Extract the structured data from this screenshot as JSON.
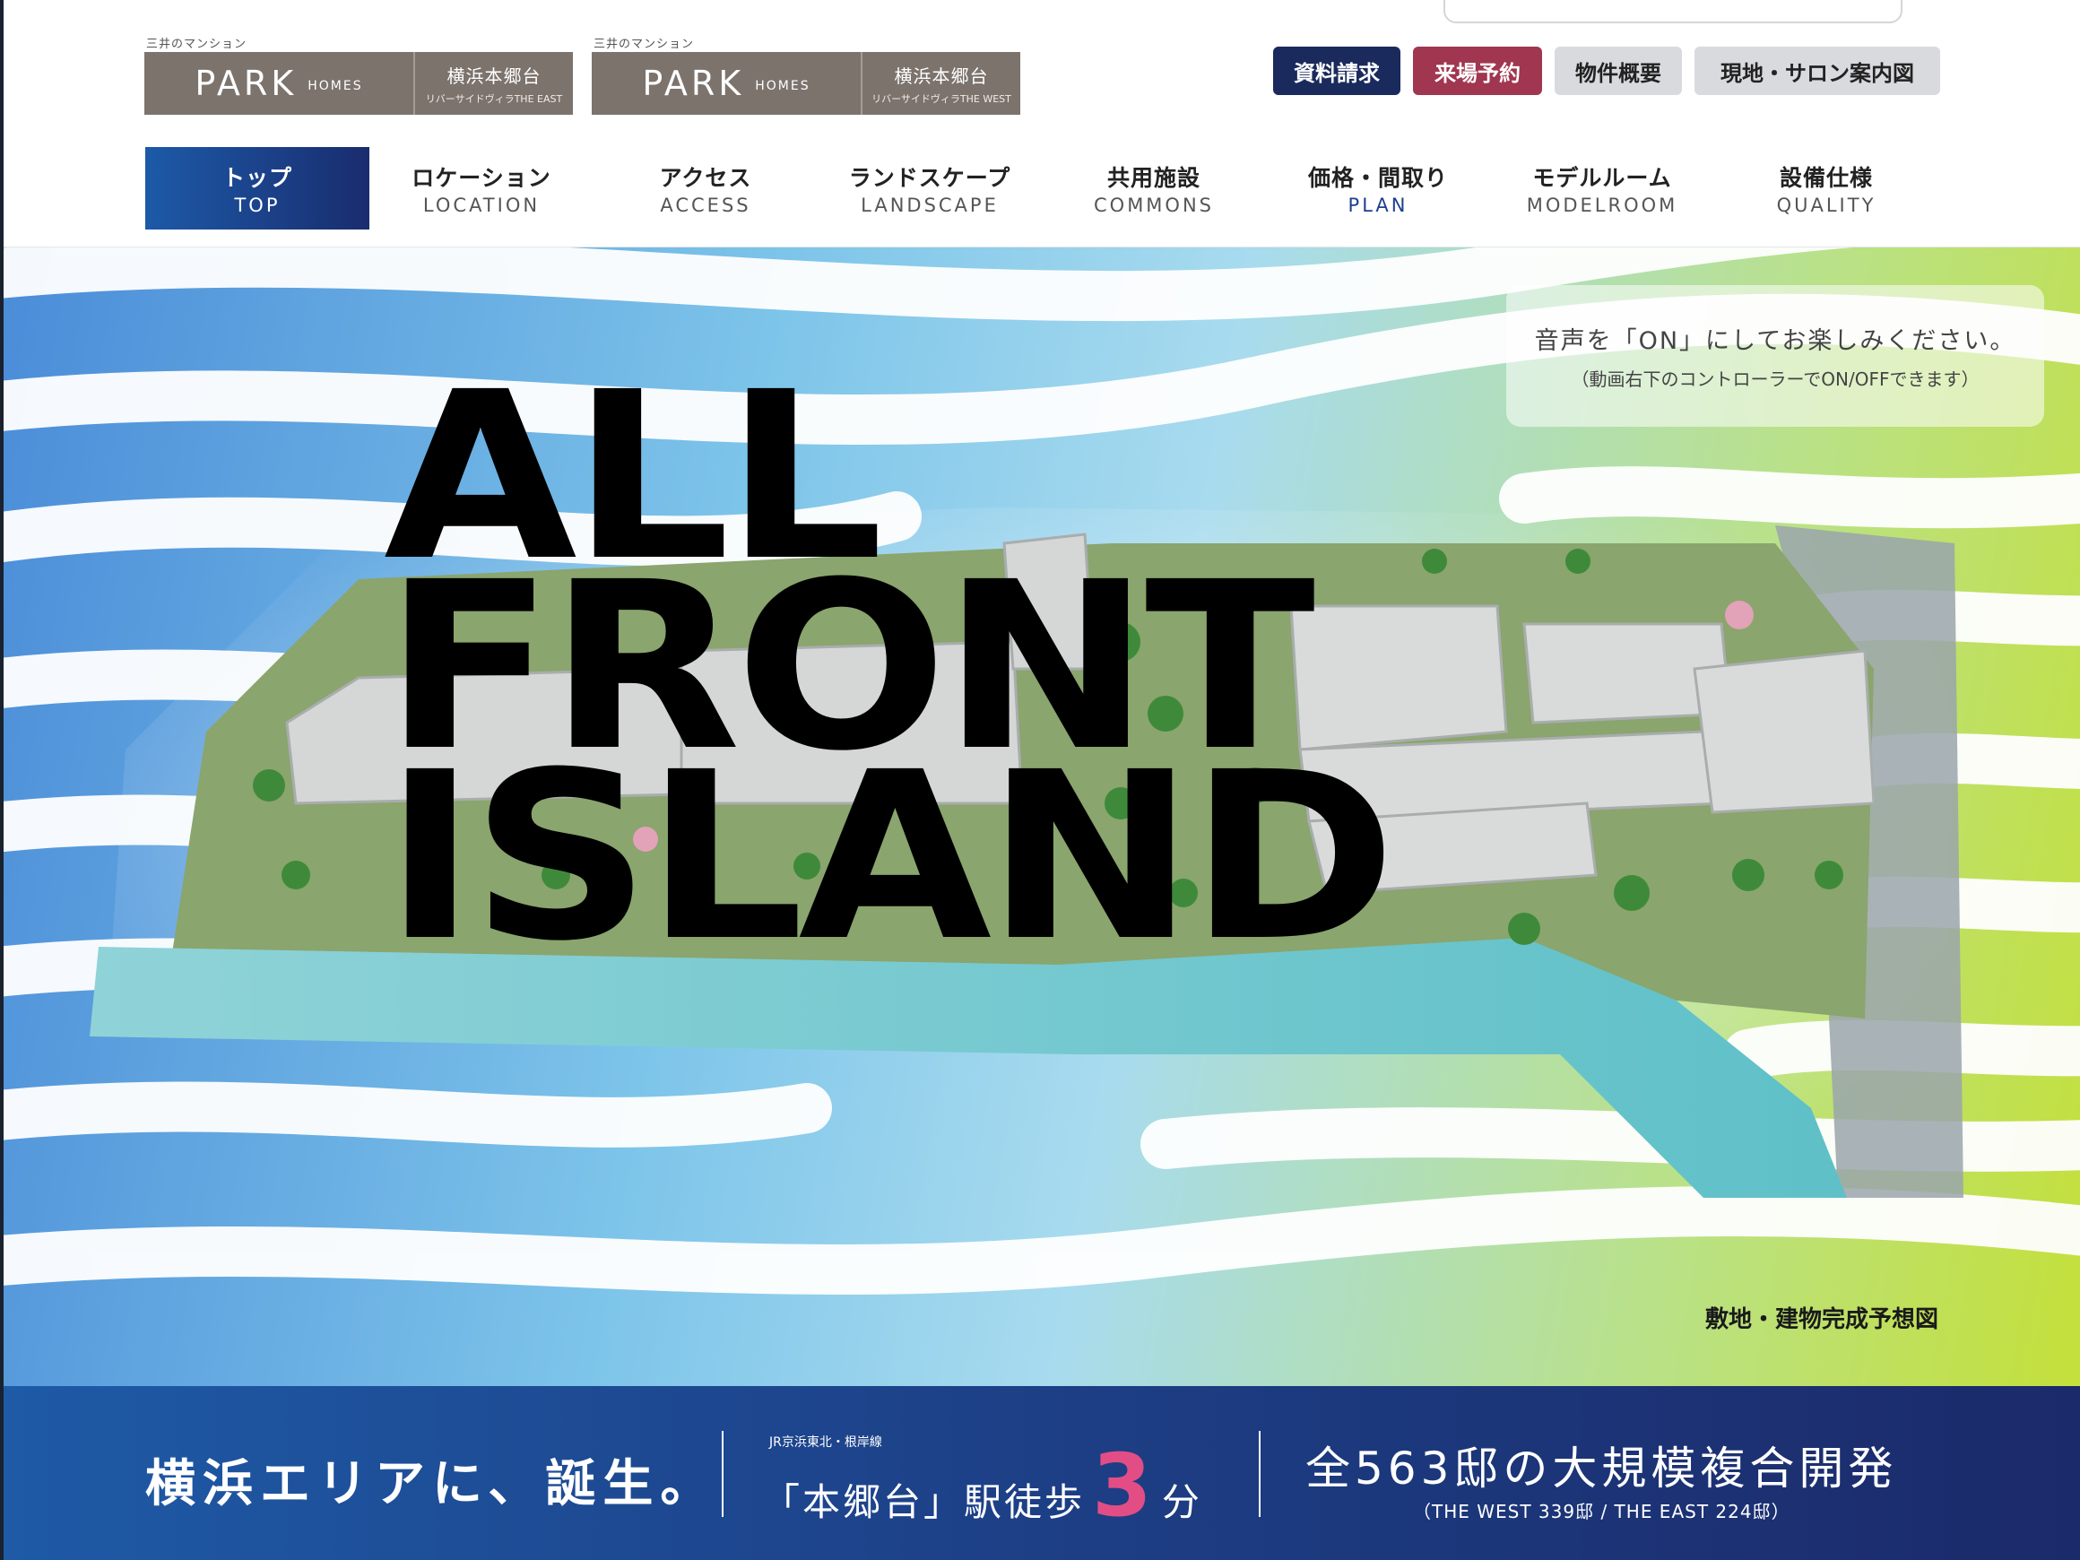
{
  "header": {
    "logos": [
      {
        "caption": "三井のマンション",
        "brand": "PARK",
        "brand_sub": "HOMES",
        "name": "横浜本郷台",
        "sub": "リバーサイドヴィラTHE EAST"
      },
      {
        "caption": "三井のマンション",
        "brand": "PARK",
        "brand_sub": "HOMES",
        "name": "横浜本郷台",
        "sub": "リバーサイドヴィラTHE WEST"
      }
    ],
    "buttons": {
      "docs": "資料請求",
      "visit": "来場予約",
      "overview": "物件概要",
      "map": "現地・サロン案内図"
    },
    "nav": [
      {
        "jp": "トップ",
        "en": "TOP",
        "active": true
      },
      {
        "jp": "ロケーション",
        "en": "LOCATION"
      },
      {
        "jp": "アクセス",
        "en": "ACCESS"
      },
      {
        "jp": "ランドスケープ",
        "en": "LANDSCAPE"
      },
      {
        "jp": "共用施設",
        "en": "COMMONS"
      },
      {
        "jp": "価格・間取り",
        "en": "PLAN"
      },
      {
        "jp": "モデルルーム",
        "en": "MODELROOM"
      },
      {
        "jp": "設備仕様",
        "en": "QUALITY"
      }
    ]
  },
  "hero": {
    "headline": [
      "ALL",
      "FRONT",
      "ISLAND"
    ],
    "sound_notice": {
      "line1": "音声を「ON」にしてお楽しみください。",
      "line2": "（動画右下のコントローラーでON/OFFできます）"
    },
    "caption": "敷地・建物完成予想図"
  },
  "band": {
    "catch": "横浜エリアに、誕生。",
    "line_name": "JR京浜東北・根岸線",
    "station": "「本郷台」駅徒歩",
    "walk_minutes": "3",
    "walk_unit": "分",
    "development": "全563邸の大規模複合開発",
    "development_sub": "（THE WEST 339邸 / THE EAST 224邸）"
  },
  "colors": {
    "brand_navy": "#1b2a5c",
    "visit_red": "#a0364f",
    "accent_pink": "#e34d86",
    "logo_brown": "#7c736d"
  }
}
